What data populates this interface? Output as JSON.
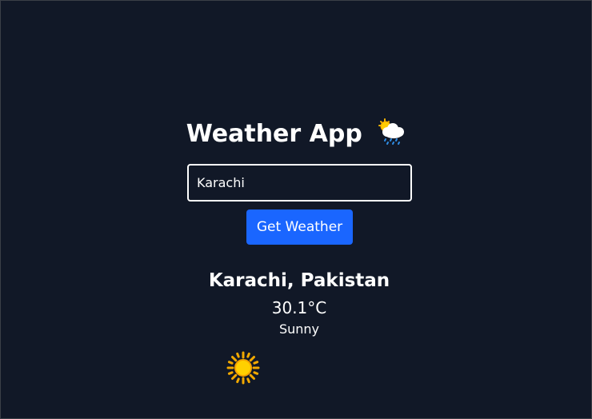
{
  "app": {
    "title": "Weather App",
    "title_icon": "sun-behind-rain-cloud-icon"
  },
  "search": {
    "value": "Karachi",
    "button_label": "Get Weather"
  },
  "result": {
    "location": "Karachi, Pakistan",
    "temperature": "30.1°C",
    "condition": "Sunny",
    "condition_icon": "sun-icon"
  },
  "colors": {
    "background": "#111827",
    "button": "#1a66ff",
    "text": "#ffffff"
  }
}
